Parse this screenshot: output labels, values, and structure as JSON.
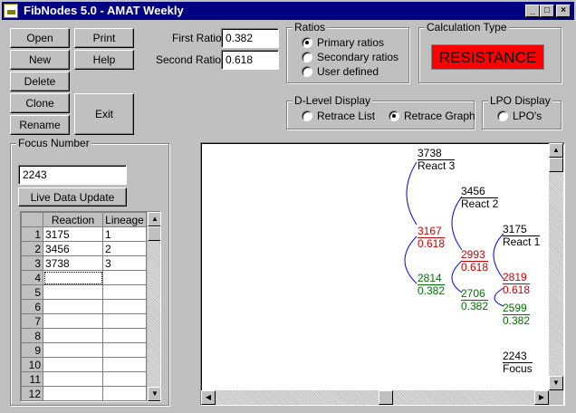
{
  "window": {
    "title": "FibNodes 5.0 - AMAT Weekly",
    "controls": {
      "minimize": "_",
      "maximize": "□",
      "close": "×"
    }
  },
  "buttons": {
    "open": "Open",
    "print": "Print",
    "new": "New",
    "help": "Help",
    "delete": "Delete",
    "clone": "Clone",
    "rename": "Rename",
    "exit": "Exit",
    "live_update": "Live Data Update"
  },
  "ratios_inputs": {
    "first_label": "First Ratio",
    "first_value": "0.382",
    "second_label": "Second Ratio",
    "second_value": "0.618"
  },
  "ratios_group": {
    "title": "Ratios",
    "options": [
      {
        "label": "Primary ratios",
        "selected": true
      },
      {
        "label": "Secondary ratios",
        "selected": false
      },
      {
        "label": "User defined",
        "selected": false
      }
    ]
  },
  "calc_type": {
    "title": "Calculation Type",
    "value": "RESISTANCE",
    "color": "#ff0000"
  },
  "dlevel": {
    "title": "D-Level Display",
    "options": [
      {
        "label": "Retrace List",
        "selected": false
      },
      {
        "label": "Retrace Graph",
        "selected": true
      }
    ]
  },
  "lpo": {
    "title": "LPO Display",
    "option": {
      "label": "LPO's",
      "selected": false
    }
  },
  "focus": {
    "title": "Focus Number",
    "value": "2243"
  },
  "grid": {
    "headers": [
      "Reaction",
      "Lineage"
    ],
    "rows": [
      {
        "n": "1",
        "reaction": "3175",
        "lineage": "1"
      },
      {
        "n": "2",
        "reaction": "3456",
        "lineage": "2"
      },
      {
        "n": "3",
        "reaction": "3738",
        "lineage": "3"
      },
      {
        "n": "4",
        "reaction": "",
        "lineage": ""
      },
      {
        "n": "5",
        "reaction": "",
        "lineage": ""
      },
      {
        "n": "6",
        "reaction": "",
        "lineage": ""
      },
      {
        "n": "7",
        "reaction": "",
        "lineage": ""
      },
      {
        "n": "8",
        "reaction": "",
        "lineage": ""
      },
      {
        "n": "9",
        "reaction": "",
        "lineage": ""
      },
      {
        "n": "10",
        "reaction": "",
        "lineage": ""
      },
      {
        "n": "11",
        "reaction": "",
        "lineage": ""
      },
      {
        "n": "12",
        "reaction": "",
        "lineage": ""
      }
    ]
  },
  "graph": {
    "colors": {
      "bracket": "#0000ff",
      "red": "#cc0000",
      "green": "#007000"
    },
    "nodes": [
      {
        "value": "3738",
        "label": "React 3"
      },
      {
        "value": "3456",
        "label": "React 2"
      },
      {
        "value": "3175",
        "label": "React 1"
      },
      {
        "value": "2243",
        "label": "Focus"
      }
    ],
    "levels": [
      {
        "red_value": "3167",
        "red_ratio": "0.618",
        "green_value": "2814",
        "green_ratio": "0.382"
      },
      {
        "red_value": "2993",
        "red_ratio": "0.618",
        "green_value": "2706",
        "green_ratio": "0.382"
      },
      {
        "red_value": "2819",
        "red_ratio": "0.618",
        "green_value": "2599",
        "green_ratio": "0.382"
      }
    ]
  }
}
